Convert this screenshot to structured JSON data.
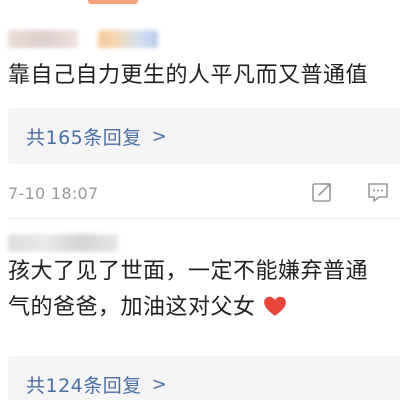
{
  "comments": [
    {
      "text_lines": [
        "靠自己自力更生的人平凡而又普通值"
      ],
      "reply_count_label": "共165条回复",
      "reply_chevron": ">",
      "timestamp": "7-10 18:07"
    },
    {
      "text_lines": [
        "孩大了见了世面，一定不能嫌弃普通",
        "气的爸爸，加油这对父女"
      ],
      "emoji": "heart-icon",
      "reply_count_label": "共124条回复",
      "reply_chevron": ">"
    }
  ],
  "icons": {
    "share": "share-icon",
    "comment": "comment-icon"
  },
  "colors": {
    "link": "#4a6fa5",
    "timestamp": "#9a9a9a",
    "reply_bg": "#f5f5f5",
    "heart": "#e8443a"
  }
}
